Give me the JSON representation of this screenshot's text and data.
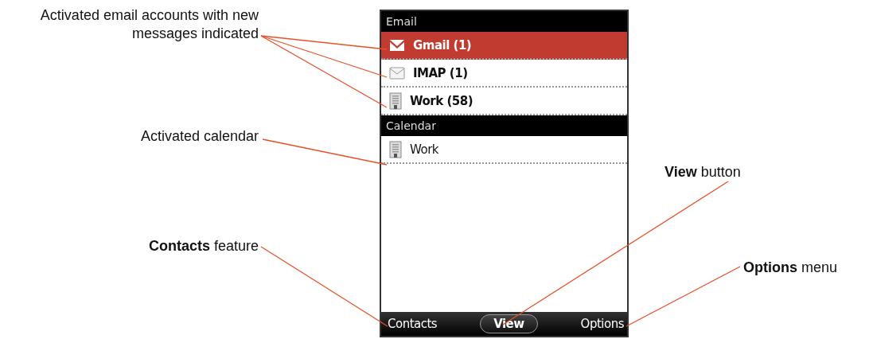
{
  "phone": {
    "sections": [
      {
        "title": "Email",
        "items": [
          {
            "label": "Gmail (1)",
            "kind": "gmail",
            "selected": true,
            "unread": true
          },
          {
            "label": "IMAP (1)",
            "kind": "envelope",
            "selected": false,
            "unread": true
          },
          {
            "label": "Work (58)",
            "kind": "building",
            "selected": false,
            "unread": true
          }
        ]
      },
      {
        "title": "Calendar",
        "items": [
          {
            "label": "Work",
            "kind": "building",
            "selected": false,
            "unread": false
          }
        ]
      }
    ],
    "softkeys": {
      "left": "Contacts",
      "center": "View",
      "right": "Options"
    }
  },
  "left_callouts": [
    {
      "text": "Activated email accounts with new messages indicated"
    },
    {
      "text": "Activated calendar"
    },
    {
      "text": "**Contacts** feature"
    }
  ],
  "right_callouts": [
    {
      "text": "**View** button"
    },
    {
      "text": "**Options** menu"
    }
  ]
}
